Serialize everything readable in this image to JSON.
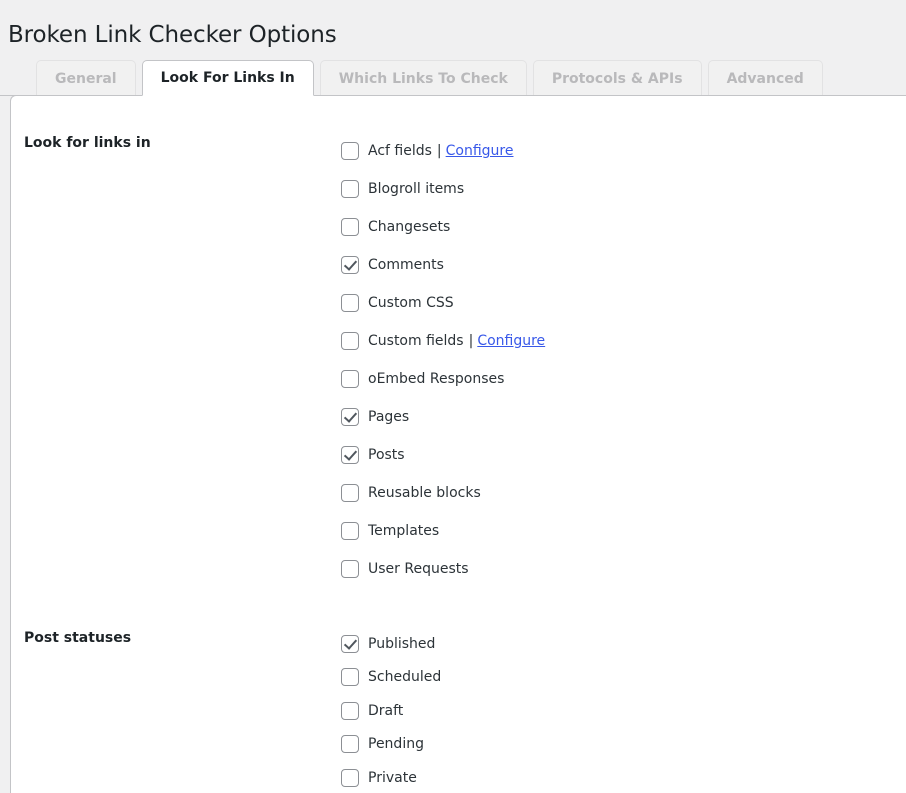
{
  "page": {
    "title": "Broken Link Checker Options",
    "background_color": "#f0f0f1",
    "link_color": "#3858e9"
  },
  "tabs": [
    {
      "label": "General",
      "active": false
    },
    {
      "label": "Look For Links In",
      "active": true
    },
    {
      "label": "Which Links To Check",
      "active": false
    },
    {
      "label": "Protocols & APIs",
      "active": false
    },
    {
      "label": "Advanced",
      "active": false
    }
  ],
  "sections": [
    {
      "label": "Look for links in",
      "options": [
        {
          "label": "Acf fields",
          "checked": false,
          "separator": "|",
          "link": "Configure"
        },
        {
          "label": "Blogroll items",
          "checked": false
        },
        {
          "label": "Changesets",
          "checked": false
        },
        {
          "label": "Comments",
          "checked": true
        },
        {
          "label": "Custom CSS",
          "checked": false
        },
        {
          "label": "Custom fields",
          "checked": false,
          "separator": "|",
          "link": "Configure"
        },
        {
          "label": "oEmbed Responses",
          "checked": false
        },
        {
          "label": "Pages",
          "checked": true
        },
        {
          "label": "Posts",
          "checked": true
        },
        {
          "label": "Reusable blocks",
          "checked": false
        },
        {
          "label": "Templates",
          "checked": false
        },
        {
          "label": "User Requests",
          "checked": false
        }
      ]
    },
    {
      "label": "Post statuses",
      "options": [
        {
          "label": "Published",
          "checked": true
        },
        {
          "label": "Scheduled",
          "checked": false
        },
        {
          "label": "Draft",
          "checked": false
        },
        {
          "label": "Pending",
          "checked": false
        },
        {
          "label": "Private",
          "checked": false
        }
      ]
    }
  ]
}
